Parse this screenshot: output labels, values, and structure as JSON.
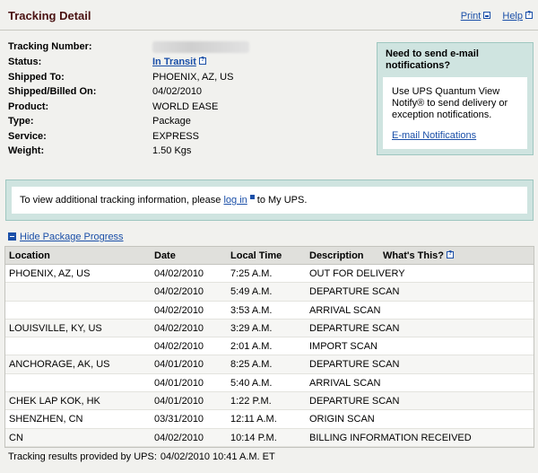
{
  "page": {
    "title": "Tracking Detail",
    "links": {
      "print": "Print",
      "help": "Help"
    }
  },
  "details": [
    {
      "label": "Tracking Number:",
      "value": ""
    },
    {
      "label": "Status:",
      "value": "In Transit"
    },
    {
      "label": "Shipped To:",
      "value": "PHOENIX, AZ, US"
    },
    {
      "label": "Shipped/Billed On:",
      "value": "04/02/2010"
    },
    {
      "label": "Product:",
      "value": "WORLD EASE"
    },
    {
      "label": "Type:",
      "value": "Package"
    },
    {
      "label": "Service:",
      "value": "EXPRESS"
    },
    {
      "label": "Weight:",
      "value": "1.50 Kgs"
    }
  ],
  "notify": {
    "heading": "Need to send e-mail notifications?",
    "body": "Use UPS Quantum View Notify® to send delivery or exception notifications.",
    "link": "E-mail Notifications"
  },
  "login": {
    "before": "To view additional tracking information, please",
    "link": "log in",
    "after": "to My UPS."
  },
  "progress": {
    "toggle": "Hide Package Progress",
    "headers": {
      "location": "Location",
      "date": "Date",
      "time": "Local Time",
      "description": "Description",
      "whats_this": "What's This?"
    },
    "rows": [
      {
        "location": "PHOENIX, AZ, US",
        "date": "04/02/2010",
        "time": "7:25 A.M.",
        "description": "OUT FOR DELIVERY"
      },
      {
        "location": "",
        "date": "04/02/2010",
        "time": "5:49 A.M.",
        "description": "DEPARTURE SCAN"
      },
      {
        "location": "",
        "date": "04/02/2010",
        "time": "3:53 A.M.",
        "description": "ARRIVAL SCAN"
      },
      {
        "location": "LOUISVILLE, KY, US",
        "date": "04/02/2010",
        "time": "3:29 A.M.",
        "description": "DEPARTURE SCAN"
      },
      {
        "location": "",
        "date": "04/02/2010",
        "time": "2:01 A.M.",
        "description": "IMPORT SCAN"
      },
      {
        "location": "ANCHORAGE, AK, US",
        "date": "04/01/2010",
        "time": "8:25 A.M.",
        "description": "DEPARTURE SCAN"
      },
      {
        "location": "",
        "date": "04/01/2010",
        "time": "5:40 A.M.",
        "description": "ARRIVAL SCAN"
      },
      {
        "location": "CHEK LAP KOK, HK",
        "date": "04/01/2010",
        "time": "1:22 P.M.",
        "description": "DEPARTURE SCAN"
      },
      {
        "location": "SHENZHEN, CN",
        "date": "03/31/2010",
        "time": "12:11 A.M.",
        "description": "ORIGIN SCAN"
      },
      {
        "location": "CN",
        "date": "04/02/2010",
        "time": "10:14 P.M.",
        "description": "BILLING INFORMATION RECEIVED"
      }
    ]
  },
  "footer": {
    "text": "Tracking results provided by UPS:",
    "timestamp": "04/02/2010 10:41 A.M.  ET"
  },
  "colors": {
    "title": "#4a1212",
    "link": "#1a4fa8",
    "panel": "#cfe4e0",
    "background": "#f1f1ee"
  }
}
